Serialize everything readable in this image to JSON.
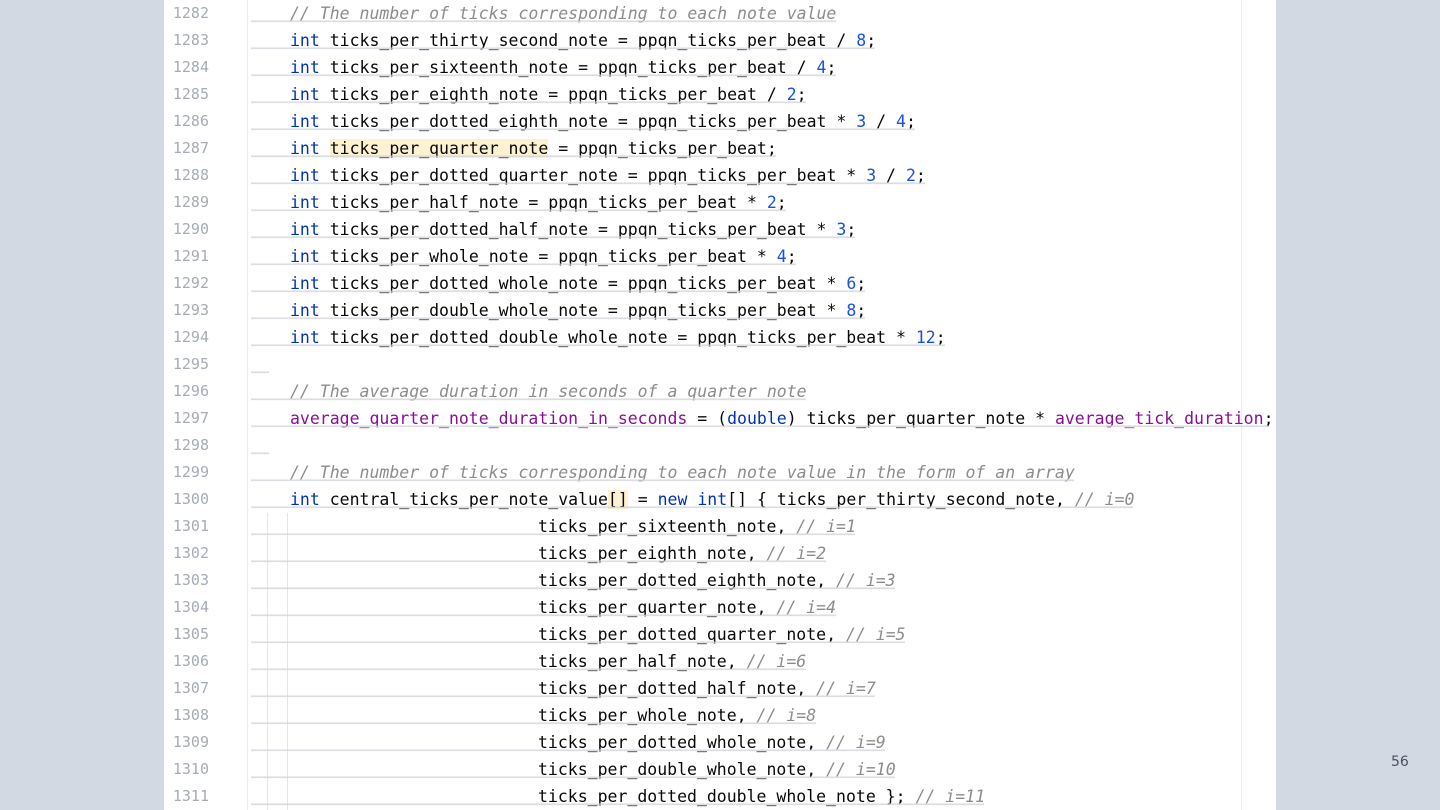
{
  "editor": {
    "lines": [
      {
        "no": "1282",
        "indent": 0,
        "tokens": [
          [
            "cmt",
            "// The number of ticks corresponding to each note value"
          ]
        ]
      },
      {
        "no": "1283",
        "indent": 0,
        "tokens": [
          [
            "kw",
            "int"
          ],
          [
            "t",
            " ticks_per_thirty_second_note = ppqn_ticks_per_beat / "
          ],
          [
            "num",
            "8"
          ],
          [
            "t",
            ";"
          ]
        ]
      },
      {
        "no": "1284",
        "indent": 0,
        "tokens": [
          [
            "kw",
            "int"
          ],
          [
            "t",
            " ticks_per_sixteenth_note = ppqn_ticks_per_beat / "
          ],
          [
            "num",
            "4"
          ],
          [
            "t",
            ";"
          ]
        ]
      },
      {
        "no": "1285",
        "indent": 0,
        "tokens": [
          [
            "kw",
            "int"
          ],
          [
            "t",
            " ticks_per_eighth_note = ppqn_ticks_per_beat / "
          ],
          [
            "num",
            "2"
          ],
          [
            "t",
            ";"
          ]
        ]
      },
      {
        "no": "1286",
        "indent": 0,
        "tokens": [
          [
            "kw",
            "int"
          ],
          [
            "t",
            " ticks_per_dotted_eighth_note = ppqn_ticks_per_beat * "
          ],
          [
            "num",
            "3"
          ],
          [
            "t",
            " / "
          ],
          [
            "num",
            "4"
          ],
          [
            "t",
            ";"
          ]
        ]
      },
      {
        "no": "1287",
        "indent": 0,
        "tokens": [
          [
            "kw",
            "int"
          ],
          [
            "t",
            " "
          ],
          [
            "hl",
            "ticks_per_quarter_note"
          ],
          [
            "t",
            " = ppqn_ticks_per_beat;"
          ]
        ]
      },
      {
        "no": "1288",
        "indent": 0,
        "tokens": [
          [
            "kw",
            "int"
          ],
          [
            "t",
            " ticks_per_dotted_quarter_note = ppqn_ticks_per_beat * "
          ],
          [
            "num",
            "3"
          ],
          [
            "t",
            " / "
          ],
          [
            "num",
            "2"
          ],
          [
            "t",
            ";"
          ]
        ]
      },
      {
        "no": "1289",
        "indent": 0,
        "tokens": [
          [
            "kw",
            "int"
          ],
          [
            "t",
            " ticks_per_half_note = ppqn_ticks_per_beat * "
          ],
          [
            "num",
            "2"
          ],
          [
            "t",
            ";"
          ]
        ]
      },
      {
        "no": "1290",
        "indent": 0,
        "tokens": [
          [
            "kw",
            "int"
          ],
          [
            "t",
            " ticks_per_dotted_half_note = ppqn_ticks_per_beat * "
          ],
          [
            "num",
            "3"
          ],
          [
            "t",
            ";"
          ]
        ]
      },
      {
        "no": "1291",
        "indent": 0,
        "tokens": [
          [
            "kw",
            "int"
          ],
          [
            "t",
            " ticks_per_whole_note = ppqn_ticks_per_beat * "
          ],
          [
            "num",
            "4"
          ],
          [
            "t",
            ";"
          ]
        ]
      },
      {
        "no": "1292",
        "indent": 0,
        "tokens": [
          [
            "kw",
            "int"
          ],
          [
            "t",
            " ticks_per_dotted_whole_note = ppqn_ticks_per_beat * "
          ],
          [
            "num",
            "6"
          ],
          [
            "t",
            ";"
          ]
        ]
      },
      {
        "no": "1293",
        "indent": 0,
        "tokens": [
          [
            "kw",
            "int"
          ],
          [
            "t",
            " ticks_per_double_whole_note = ppqn_ticks_per_beat * "
          ],
          [
            "num",
            "8"
          ],
          [
            "t",
            ";"
          ]
        ]
      },
      {
        "no": "1294",
        "indent": 0,
        "tokens": [
          [
            "kw",
            "int"
          ],
          [
            "t",
            " ticks_per_dotted_double_whole_note = ppqn_ticks_per_beat * "
          ],
          [
            "num",
            "12"
          ],
          [
            "t",
            ";"
          ]
        ]
      },
      {
        "no": "1295",
        "indent": 0,
        "tokens": []
      },
      {
        "no": "1296",
        "indent": 0,
        "tokens": [
          [
            "cmt",
            "// The average duration in seconds of a quarter note"
          ]
        ]
      },
      {
        "no": "1297",
        "indent": 0,
        "tokens": [
          [
            "fld",
            "average_quarter_note_duration_in_seconds"
          ],
          [
            "t",
            " = ("
          ],
          [
            "kw",
            "double"
          ],
          [
            "t",
            ") ticks_per_quarter_note * "
          ],
          [
            "fld",
            "average_tick_duration"
          ],
          [
            "t",
            ";"
          ]
        ]
      },
      {
        "no": "1298",
        "indent": 0,
        "tokens": []
      },
      {
        "no": "1299",
        "indent": 0,
        "tokens": [
          [
            "cmt",
            "// The number of ticks corresponding to each note value in the form of an array"
          ]
        ]
      },
      {
        "no": "1300",
        "indent": 0,
        "tokens": [
          [
            "kw",
            "int"
          ],
          [
            "t",
            " central_ticks_per_note_value"
          ],
          [
            "br",
            "[]"
          ],
          [
            "t",
            " = "
          ],
          [
            "kw",
            "new"
          ],
          [
            "t",
            " "
          ],
          [
            "kw",
            "int"
          ],
          [
            "t",
            "[] { ticks_per_thirty_second_note, "
          ],
          [
            "cmt",
            "// i=0"
          ]
        ]
      },
      {
        "no": "1301",
        "indent": 1,
        "tokens": [
          [
            "t",
            "ticks_per_sixteenth_note, "
          ],
          [
            "cmt",
            "// i=1"
          ]
        ]
      },
      {
        "no": "1302",
        "indent": 1,
        "tokens": [
          [
            "t",
            "ticks_per_eighth_note, "
          ],
          [
            "cmt",
            "// i=2"
          ]
        ]
      },
      {
        "no": "1303",
        "indent": 1,
        "tokens": [
          [
            "t",
            "ticks_per_dotted_eighth_note, "
          ],
          [
            "cmt",
            "// i=3"
          ]
        ]
      },
      {
        "no": "1304",
        "indent": 1,
        "tokens": [
          [
            "t",
            "ticks_per_quarter_note, "
          ],
          [
            "cmt",
            "// i=4"
          ]
        ]
      },
      {
        "no": "1305",
        "indent": 1,
        "tokens": [
          [
            "t",
            "ticks_per_dotted_quarter_note, "
          ],
          [
            "cmt",
            "// i=5"
          ]
        ]
      },
      {
        "no": "1306",
        "indent": 1,
        "tokens": [
          [
            "t",
            "ticks_per_half_note, "
          ],
          [
            "cmt",
            "// i=6"
          ]
        ]
      },
      {
        "no": "1307",
        "indent": 1,
        "tokens": [
          [
            "t",
            "ticks_per_dotted_half_note, "
          ],
          [
            "cmt",
            "// i=7"
          ]
        ]
      },
      {
        "no": "1308",
        "indent": 1,
        "tokens": [
          [
            "t",
            "ticks_per_whole_note, "
          ],
          [
            "cmt",
            "// i=8"
          ]
        ]
      },
      {
        "no": "1309",
        "indent": 1,
        "tokens": [
          [
            "t",
            "ticks_per_dotted_whole_note, "
          ],
          [
            "cmt",
            "// i=9"
          ]
        ]
      },
      {
        "no": "1310",
        "indent": 1,
        "tokens": [
          [
            "t",
            "ticks_per_double_whole_note, "
          ],
          [
            "cmt",
            "// i=10"
          ]
        ]
      },
      {
        "no": "1311",
        "indent": 1,
        "tokens": [
          [
            "t",
            "ticks_per_dotted_double_whole_note }; "
          ],
          [
            "cmt",
            "// i=11"
          ]
        ]
      }
    ]
  },
  "page_number": "56",
  "colors": {
    "keyword": "#0033b3",
    "number": "#1750eb",
    "field": "#871094",
    "comment": "#8c8c8c",
    "highlight": "#fcf1d0",
    "background": "#d3d9e3"
  }
}
